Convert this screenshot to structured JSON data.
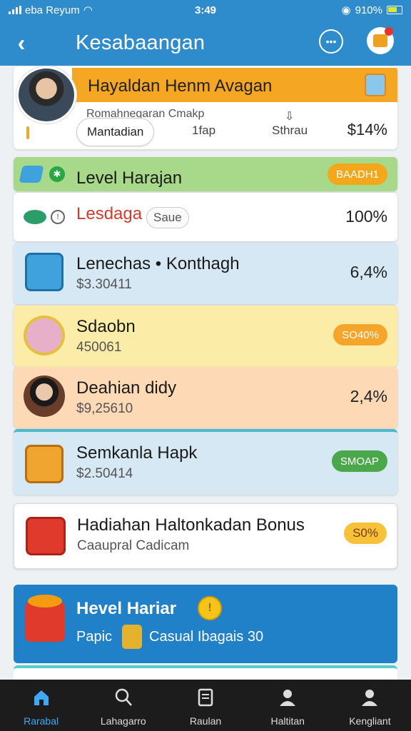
{
  "status_bar": {
    "carrier": "eba Reyum",
    "time": "3:49",
    "battery": "910%"
  },
  "header": {
    "title": "Kesabaangan"
  },
  "profile": {
    "name": "Hayaldan Henm Avagan",
    "subtitle": "Romahnegaran Cmakp",
    "tabs": [
      "Mantadian",
      "1fap",
      "Sthrau"
    ],
    "value": "$14%"
  },
  "level_section": {
    "title": "Level Harajan",
    "badge": "BAADH1",
    "badge_color": "#f2a81a"
  },
  "rows": [
    {
      "title": "Lesdaga",
      "chip": "Saue",
      "value": "100%"
    },
    {
      "title": "Lenechas • Konthagh",
      "sub": "$3.30411",
      "value": "6,4%"
    },
    {
      "title": "Sdaobn",
      "sub": "450061",
      "pill": "SO40%",
      "pill_color": "#f5a52a"
    },
    {
      "title": "Deahian didy",
      "sub": "$9,25610",
      "value": "2,4%"
    },
    {
      "title": "Semkanla Hapk",
      "sub": "$2.50414",
      "pill": "SMOAP",
      "pill_color": "#4aa84a"
    },
    {
      "title": "Hadiahan Haltonkadan Bonus",
      "sub": "Caaupral Cadicam",
      "pill": "S0%",
      "pill_color": "#f6c23a"
    }
  ],
  "promo": {
    "title": "Hevel Hariar",
    "sub": "Papic",
    "sub2": "Casual Ibagais 30"
  },
  "bottom_nav": [
    {
      "label": "Rarabal",
      "icon": "home-icon"
    },
    {
      "label": "Lahagarro",
      "icon": "search-icon"
    },
    {
      "label": "Raulan",
      "icon": "document-icon"
    },
    {
      "label": "Haltitan",
      "icon": "person-icon"
    },
    {
      "label": "Kengliant",
      "icon": "profile-icon"
    }
  ]
}
